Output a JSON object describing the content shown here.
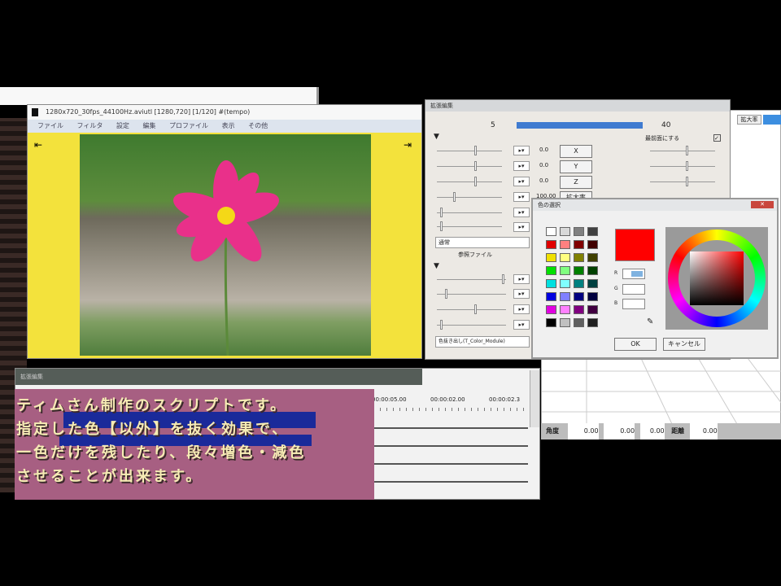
{
  "main_window": {
    "title": "1280x720_30fps_44100Hz.aviutl [1280,720] [1/120] #(tempo)",
    "menu": [
      "ファイル",
      "フィルタ",
      "設定",
      "編集",
      "プロファイル",
      "表示",
      "その他"
    ]
  },
  "settings_dialog": {
    "title": "拡張編集",
    "frame_start": "5",
    "frame_end": "40",
    "axis_labels": [
      "X",
      "Y",
      "Z"
    ],
    "values": [
      "0.0",
      "0.0",
      "0.0",
      "100.00"
    ],
    "zoom_label": "拡大率",
    "check_label": "最前面にする",
    "blend_mode": "通常",
    "ref_file": "参照ファイル",
    "script_select": "色抜き出し(T_Color_Module)"
  },
  "color_dialog": {
    "title": "色の選択",
    "ok": "OK",
    "cancel": "キャンセル",
    "selected_color": "#ff0000",
    "field_labels": [
      "R",
      "G",
      "B"
    ],
    "palette": [
      "#ffffff",
      "#d8d8d8",
      "#808080",
      "#404040",
      "#e00000",
      "#ff8080",
      "#800000",
      "#400000",
      "#f0e000",
      "#ffff80",
      "#808000",
      "#404000",
      "#00e000",
      "#80ff80",
      "#008000",
      "#004000",
      "#00e0e0",
      "#80ffff",
      "#008080",
      "#004040",
      "#0000e0",
      "#8080ff",
      "#000080",
      "#000040",
      "#e000e0",
      "#ff80ff",
      "#800080",
      "#400040",
      "#000000",
      "#c0c0c0",
      "#606060",
      "#202020"
    ]
  },
  "timeline": {
    "title": "拡張編集",
    "times": [
      "00:00:05.00",
      "00:00:02.00",
      "00:00:02.3"
    ]
  },
  "status_bar": {
    "label": "角度",
    "values": [
      "0.00",
      "0.00",
      "0.00"
    ],
    "label2": "距離",
    "value2": "0.00"
  },
  "right_tabs": [
    "拡大率"
  ],
  "caption": {
    "lines": [
      "ティムさん制作のスクリプトです。",
      "指定した色【以外】を抜く効果で、",
      "一色だけを残したり、段々増色・減色",
      "させることが出来ます。"
    ]
  },
  "colors": {
    "yellow_bg": "#f3e23c",
    "caption_bg": "#a75f82",
    "highlight": "#1a2a9a"
  }
}
